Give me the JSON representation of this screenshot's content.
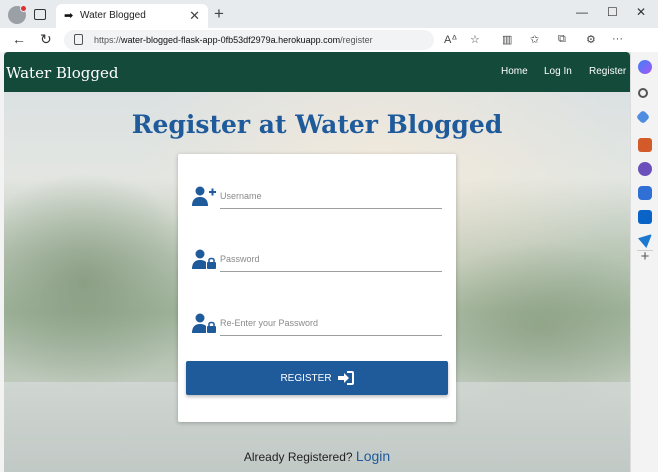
{
  "browser": {
    "tab_title": "Water Blogged",
    "url_prefix": "https://",
    "url_domain": "water-blogged-flask-app-0fb53df2979a.herokuapp.com",
    "url_path": "/register",
    "tab_close": "✕",
    "new_tab": "+",
    "min": "—",
    "max": "☐",
    "close": "✕"
  },
  "navbar": {
    "brand": "Water Blogged",
    "links": [
      "Home",
      "Log In",
      "Register"
    ],
    "color": "#134a3a"
  },
  "page": {
    "heading": "Register at Water Blogged",
    "accent": "#1f5a9b"
  },
  "form": {
    "username_placeholder": "Username",
    "password_placeholder": "Password",
    "repassword_placeholder": "Re-Enter your Password",
    "submit_label": "REGISTER",
    "username_icon": "user-plus-icon",
    "password_icon": "user-lock-icon",
    "submit_icon": "sign-in-icon"
  },
  "footer": {
    "already_text": "Already Registered?",
    "login_link": "Login"
  }
}
